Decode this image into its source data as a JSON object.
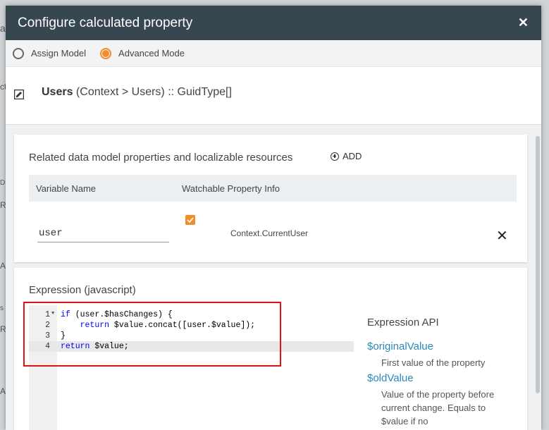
{
  "background": {
    "fragments": [
      "al",
      "ct",
      "DE",
      "RA",
      "A",
      "s",
      "RA",
      "Ap"
    ]
  },
  "dialog": {
    "title": "Configure calculated property",
    "close_icon": "close-icon"
  },
  "mode": {
    "options": [
      {
        "label": "Assign Model",
        "selected": false
      },
      {
        "label": "Advanced Mode",
        "selected": true
      }
    ]
  },
  "property": {
    "name": "Users",
    "path": " (Context > Users) :: GuidType[]"
  },
  "related": {
    "title": "Related data model properties and localizable resources",
    "add_label": "ADD",
    "columns": [
      "Variable Name",
      "Watchable Property Info"
    ],
    "rows": [
      {
        "variable": "user",
        "watchable": true,
        "info": "Context.CurrentUser"
      }
    ]
  },
  "expression": {
    "title": "Expression (javascript)",
    "lines": [
      {
        "n": "1",
        "text": "if (user.$hasChanges) {"
      },
      {
        "n": "2",
        "text": "    return $value.concat([user.$value]);"
      },
      {
        "n": "3",
        "text": "}"
      },
      {
        "n": "4",
        "text": "return $value;"
      }
    ],
    "active_line": 4
  },
  "api": {
    "title": "Expression API",
    "items": [
      {
        "name": "$originalValue",
        "desc": "First value of the property"
      },
      {
        "name": "$oldValue",
        "desc": "Value of the property before current change. Equals to $value if no"
      }
    ]
  },
  "colors": {
    "titlebar": "#37474f",
    "accent": "#f28c28",
    "link": "#2a8ab8",
    "highlight": "#e31212"
  }
}
